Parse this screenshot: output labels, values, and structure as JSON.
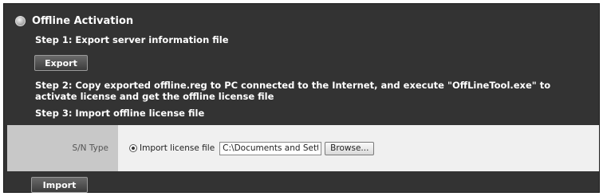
{
  "section": {
    "title": "Offline Activation",
    "icon": "activation-bullet-icon"
  },
  "steps": {
    "step1": "Step 1: Export server information file",
    "step2": "Step 2: Copy exported offline.reg to PC connected to the Internet, and execute \"OffLineTool.exe\" to activate license and get the offline license file",
    "step3": "Step 3: Import offline license file"
  },
  "buttons": {
    "export_label": "Export",
    "import_label": "Import",
    "browse_label": "Browse..."
  },
  "form": {
    "row_label": "S/N Type",
    "radio_label": "Import license file",
    "radio_selected": true,
    "file_path_value": "C:\\Documents and Sett"
  },
  "colors": {
    "panel_background": "#333333",
    "label_cell_background": "#c8c8c8",
    "value_cell_background": "#f0f0f0"
  }
}
